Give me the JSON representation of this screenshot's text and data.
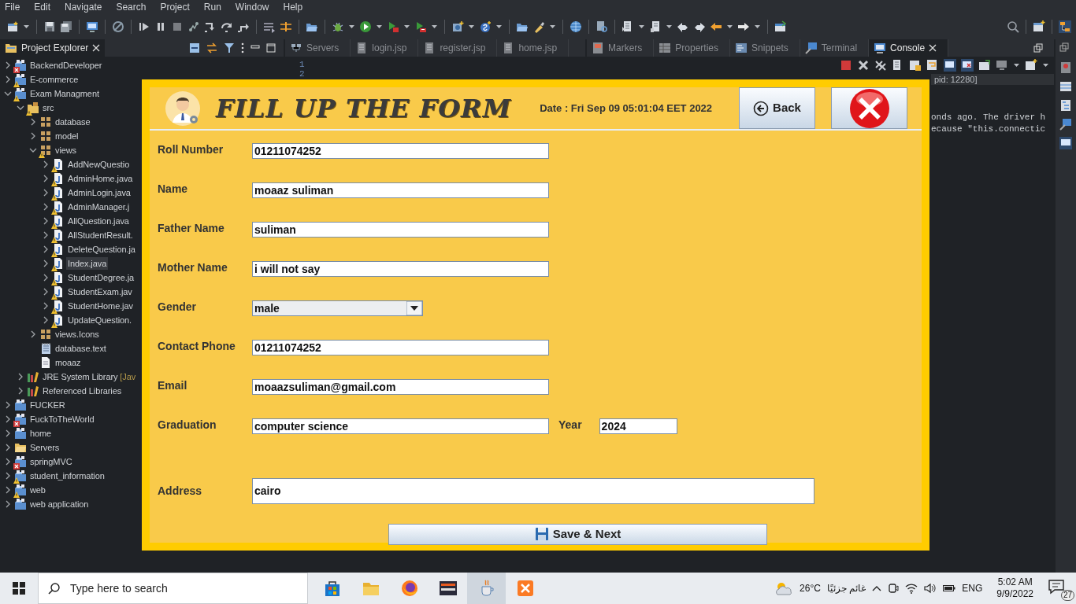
{
  "menu": [
    "File",
    "Edit",
    "Navigate",
    "Search",
    "Project",
    "Run",
    "Window",
    "Help"
  ],
  "explorer": {
    "title": "Project Explorer",
    "tree": [
      {
        "label": "BackendDeveloper",
        "kind": "project",
        "has_error": true,
        "expanded": false,
        "selected": false
      },
      {
        "label": "E-commerce",
        "kind": "project",
        "has_warning": true,
        "expanded": false,
        "selected": false
      },
      {
        "label": "Exam Managment",
        "kind": "project",
        "has_warning": true,
        "expanded": true,
        "selected": false,
        "children": [
          {
            "label": "src",
            "kind": "source-folder",
            "has_warning": true,
            "expanded": true,
            "selected": false,
            "children": [
              {
                "label": "database",
                "kind": "package",
                "expanded": false,
                "selected": false
              },
              {
                "label": "model",
                "kind": "package",
                "expanded": false,
                "selected": false
              },
              {
                "label": "views",
                "kind": "package",
                "has_warning": true,
                "expanded": true,
                "selected": false,
                "children": [
                  {
                    "label": "AddNewQuestio",
                    "kind": "java",
                    "has_warning": true,
                    "expanded": false,
                    "selected": false
                  },
                  {
                    "label": "AdminHome.java",
                    "kind": "java",
                    "has_warning": true,
                    "expanded": false,
                    "selected": false
                  },
                  {
                    "label": "AdminLogin.java",
                    "kind": "java",
                    "has_warning": true,
                    "expanded": false,
                    "selected": false
                  },
                  {
                    "label": "AdminManager.j",
                    "kind": "java",
                    "has_warning": true,
                    "expanded": false,
                    "selected": false
                  },
                  {
                    "label": "AllQuestion.java",
                    "kind": "java",
                    "has_warning": true,
                    "expanded": false,
                    "selected": false
                  },
                  {
                    "label": "AllStudentResult.",
                    "kind": "java",
                    "has_warning": true,
                    "expanded": false,
                    "selected": false
                  },
                  {
                    "label": "DeleteQuestion.ja",
                    "kind": "java",
                    "has_warning": true,
                    "expanded": false,
                    "selected": false
                  },
                  {
                    "label": "Index.java",
                    "kind": "java",
                    "has_warning": true,
                    "expanded": false,
                    "selected": true
                  },
                  {
                    "label": "StudentDegree.ja",
                    "kind": "java",
                    "has_warning": true,
                    "expanded": false,
                    "selected": false
                  },
                  {
                    "label": "StudentExam.jav",
                    "kind": "java",
                    "has_warning": true,
                    "expanded": false,
                    "selected": false
                  },
                  {
                    "label": "StudentHome.jav",
                    "kind": "java",
                    "has_warning": true,
                    "expanded": false,
                    "selected": false
                  },
                  {
                    "label": "UpdateQuestion.",
                    "kind": "java",
                    "has_warning": true,
                    "expanded": false,
                    "selected": false
                  }
                ]
              },
              {
                "label": "views.Icons",
                "kind": "package",
                "expanded": false,
                "selected": false
              },
              {
                "label": "database.text",
                "kind": "text-file",
                "selected": false
              },
              {
                "label": "moaaz",
                "kind": "file",
                "selected": false
              }
            ]
          },
          {
            "label": "JRE System Library",
            "suffix": "[Jav",
            "kind": "library",
            "expanded": false,
            "selected": false
          },
          {
            "label": "Referenced Libraries",
            "kind": "library",
            "expanded": false,
            "selected": false
          }
        ]
      },
      {
        "label": "FUCKER",
        "kind": "project",
        "expanded": false,
        "selected": false
      },
      {
        "label": "FuckToTheWorld",
        "kind": "project",
        "has_error": true,
        "expanded": false,
        "selected": false
      },
      {
        "label": "home",
        "kind": "project",
        "expanded": false,
        "selected": false
      },
      {
        "label": "Servers",
        "kind": "folder",
        "expanded": false,
        "selected": false
      },
      {
        "label": "springMVC",
        "kind": "project",
        "has_error": true,
        "expanded": false,
        "selected": false
      },
      {
        "label": "student_information",
        "kind": "project",
        "has_warning": true,
        "expanded": false,
        "selected": false
      },
      {
        "label": "web",
        "kind": "project",
        "has_warning": true,
        "expanded": false,
        "selected": false
      },
      {
        "label": "web application",
        "kind": "project",
        "expanded": false,
        "selected": false
      }
    ]
  },
  "editor": {
    "tabs": [
      {
        "label": "Servers",
        "kind": "servers",
        "selected": false
      },
      {
        "label": "login.jsp",
        "kind": "jsp",
        "selected": false
      },
      {
        "label": "register.jsp",
        "kind": "jsp",
        "selected": false
      },
      {
        "label": "home.jsp",
        "kind": "jsp",
        "selected": false
      }
    ],
    "line_numbers": [
      "1",
      "2"
    ]
  },
  "console": {
    "tabs": [
      {
        "label": "Markers",
        "kind": "markers",
        "selected": false
      },
      {
        "label": "Properties",
        "kind": "properties",
        "selected": false
      },
      {
        "label": "Snippets",
        "kind": "snippets",
        "selected": false
      },
      {
        "label": "Terminal",
        "kind": "terminal",
        "selected": false
      },
      {
        "label": "Console",
        "kind": "console",
        "selected": true
      }
    ],
    "header": "pid: 12280]",
    "lines": [
      "onds ago. The driver h",
      "ecause \"this.connectic"
    ]
  },
  "form": {
    "title": "FILL UP THE FORM",
    "date": "Date : Fri Sep 09 05:01:04 EET 2022",
    "back": "Back",
    "fields": [
      {
        "kind": "text",
        "label": "Roll Number",
        "value": "01211074252"
      },
      {
        "kind": "text",
        "label": "Name",
        "value": "moaaz suliman"
      },
      {
        "kind": "text",
        "label": "Father Name",
        "value": "suliman"
      },
      {
        "kind": "text",
        "label": "Mother Name",
        "value": "i will not say"
      },
      {
        "kind": "select",
        "label": "Gender",
        "value": "male"
      },
      {
        "kind": "text",
        "label": "Contact Phone",
        "value": "01211074252"
      },
      {
        "kind": "text",
        "label": "Email",
        "value": "moaazsuliman@gmail.com"
      },
      {
        "kind": "pair",
        "label": "Graduation",
        "value": "computer science",
        "label_2": "Year",
        "value_2": "2024"
      },
      {
        "kind": "wide",
        "label": "Address",
        "value": "cairo"
      }
    ],
    "save": "Save & Next"
  },
  "taskbar": {
    "search_placeholder": "Type here to search",
    "apps": [
      {
        "kind": "store",
        "selected": false
      },
      {
        "kind": "explorer",
        "selected": false
      },
      {
        "kind": "firefox",
        "selected": false
      },
      {
        "kind": "ide",
        "selected": false
      },
      {
        "kind": "java",
        "selected": true
      },
      {
        "kind": "xampp",
        "selected": false
      }
    ],
    "temperature": "26°C",
    "weather": "غائم جزئيًا",
    "language": "ENG",
    "time": "5:02 AM",
    "date": "9/9/2022",
    "notifications": "27"
  }
}
